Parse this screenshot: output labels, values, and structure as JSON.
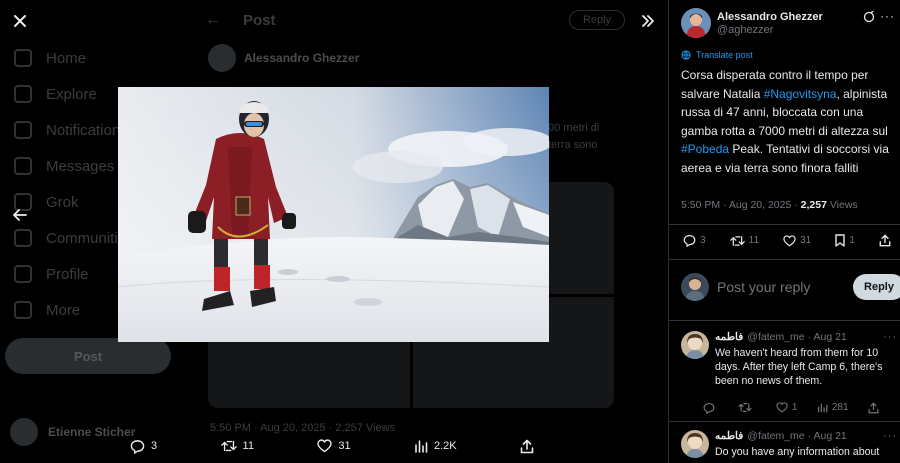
{
  "background_app": {
    "nav": [
      "Home",
      "Explore",
      "Notifications",
      "Messages",
      "Grok",
      "Communities",
      "Profile",
      "More"
    ],
    "post_button": "Post",
    "header_title": "Post",
    "header_reply": "Reply",
    "author_name": "Alessandro Ghezzer",
    "side_text": "00 metri di\nterra sono",
    "stats": "5:50 PM · Aug 20, 2025 · 2,257 Views",
    "user_name": "Etienne Sticher"
  },
  "viewer": {
    "close_icon": "close-icon",
    "prev_icon": "arrow-left-icon",
    "collapse_icon": "double-chevron-right-icon",
    "actions": {
      "replies": "3",
      "reposts": "11",
      "likes": "31",
      "views": "2.2K"
    }
  },
  "panel": {
    "author": {
      "name": "Alessandro Ghezzer",
      "handle": "@aghezzer"
    },
    "translate_label": "Translate post",
    "text": {
      "part1": "Corsa disperata contro il tempo per salvare Natalia ",
      "hashtag1": "#Nagovitsyna",
      "part2": ", alpinista russa di 47 anni, bloccata con una gamba rotta a 7000 metri di altezza sul ",
      "hashtag2": "#Pobeda",
      "part3": " Peak.  Tentativi di soccorsi via aerea e via terra sono finora falliti"
    },
    "meta": {
      "time_date": "5:50 PM · Aug 20, 2025 · ",
      "views_count": "2,257",
      "views_label": " Views"
    },
    "actions": {
      "replies": "3",
      "reposts": "11",
      "likes": "31",
      "bookmarks": "1"
    },
    "reply_box": {
      "placeholder": "Post your reply",
      "button": "Reply"
    },
    "replies": [
      {
        "name": "فاطمه",
        "handle": "@fatem_me",
        "time": "· Aug 21",
        "text": "We haven't heard from them for 10 days. After they left Camp 6, there's been no news of them.",
        "replies": "",
        "reposts": "",
        "likes": "1",
        "views": "281"
      },
      {
        "name": "فاطمه",
        "handle": "@fatem_me",
        "time": "· Aug 21",
        "text": "Do you have any information about"
      }
    ]
  },
  "colors": {
    "accent": "#1d9bf0",
    "background": "#000000",
    "text": "#e7e9ea",
    "muted": "#71767b",
    "border": "#2f3336",
    "reply_button_bg": "#cfd9de"
  }
}
